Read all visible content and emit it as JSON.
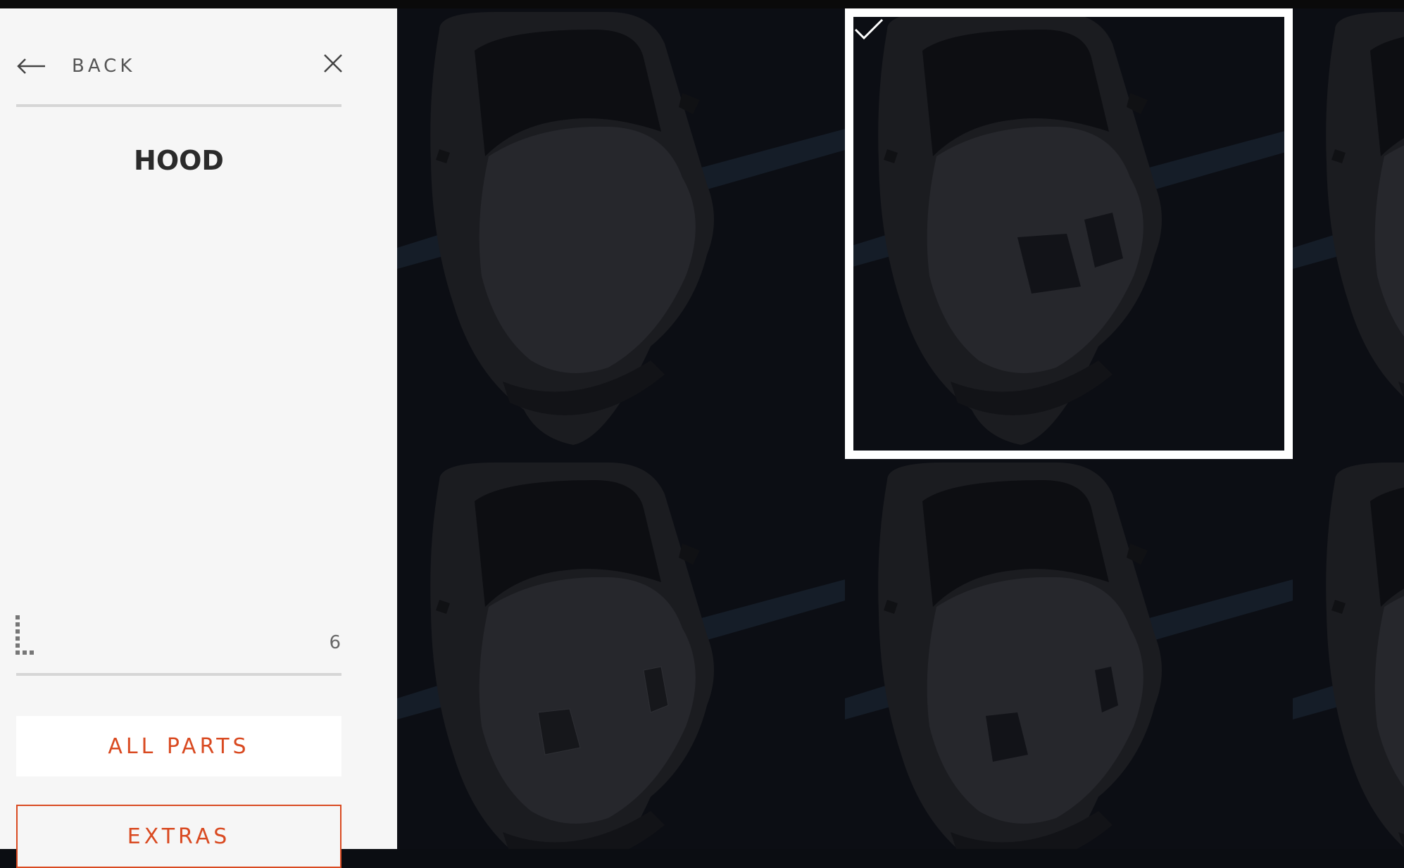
{
  "nav": {
    "back_label": "BACK"
  },
  "section": {
    "title": "HOOD"
  },
  "pagination": {
    "count": "6"
  },
  "buttons": {
    "all_parts": "ALL PARTS",
    "extras": "EXTRAS"
  },
  "colors": {
    "accent": "#d94a21",
    "sidebar_bg": "#f6f6f6",
    "gallery_bg": "#0b0d12"
  },
  "gallery": {
    "options": [
      {
        "variant": "stock hood",
        "selected": false
      },
      {
        "variant": "vented hood with large louvers",
        "selected": true
      },
      {
        "variant": "hood with side vents",
        "selected": false
      },
      {
        "variant": "hood with small louvers",
        "selected": false
      },
      {
        "variant": "hood option 5",
        "selected": false
      },
      {
        "variant": "hood option 6",
        "selected": false
      }
    ]
  }
}
